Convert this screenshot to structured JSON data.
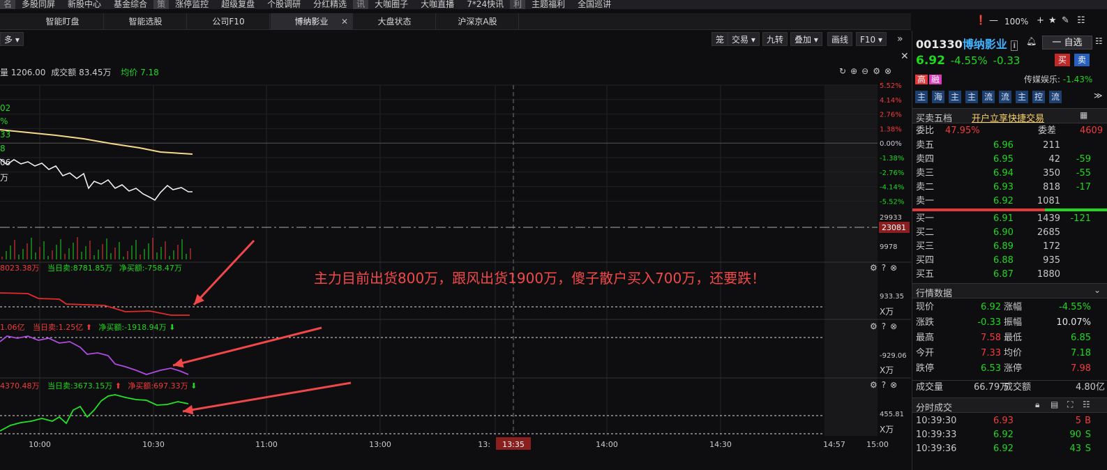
{
  "topnav": [
    "名",
    "多股同屏",
    "新股中心",
    "基金综合",
    "策",
    "涨停监控",
    "超级复盘",
    "个股调研",
    "分红精选",
    "讯",
    "大咖圈子",
    "大咖直播",
    "7*24快讯",
    "利",
    "主题福利",
    "全国巡讲"
  ],
  "tabs": [
    {
      "label": "智能盯盘",
      "active": false
    },
    {
      "label": "智能选股",
      "active": false
    },
    {
      "label": "公司F10",
      "active": false
    },
    {
      "label": "博纳影业",
      "active": true,
      "close": "✕"
    },
    {
      "label": "大盘状态",
      "active": false
    },
    {
      "label": "沪深京A股",
      "active": false
    }
  ],
  "window_controls": {
    "zoom": "100%"
  },
  "toolbar": {
    "more": "多",
    "btns": [
      "笼",
      "交易",
      "九转",
      "叠加",
      "画线",
      "F10"
    ]
  },
  "chart_header": {
    "vol": "量 1206.00",
    "amount": "成交额 83.45万",
    "avg": "均价 7.18"
  },
  "yaxis_pct": [
    "5.52%",
    "4.14%",
    "2.76%",
    "1.38%",
    "0.00%",
    "-1.38%",
    "-2.76%",
    "-4.14%",
    "-5.52%"
  ],
  "vol_axis": {
    "top": "29933",
    "mid": "23081",
    "low": "9978"
  },
  "left_edge_labels": [
    "02",
    "%",
    "33",
    "8",
    "06",
    "万"
  ],
  "panel1": {
    "label1": "8023.38万",
    "label2": "当日卖:8781.85万",
    "label3": "净买额:-758.47万",
    "axis": "933.35",
    "unit": "X万"
  },
  "panel2": {
    "label1": "1.06亿",
    "label2": "当日卖:1.25亿",
    "label3": "净买额:-1918.94万",
    "axis": "-929.06",
    "unit": "X万"
  },
  "panel3": {
    "label1": "4370.48万",
    "label2": "当日卖:3673.15万",
    "label3": "净买额:697.33万",
    "axis": "455.81",
    "unit": "X万"
  },
  "annotation": "主力目前出货800万，跟风出货1900万，傻子散户买入700万，还要跌！",
  "time_axis": [
    "10:00",
    "10:30",
    "11:00",
    "13:00",
    "13:35",
    "14:00",
    "14:30",
    "14:57",
    "15:00"
  ],
  "stock": {
    "code": "001330",
    "name": "博纳影业",
    "price": "6.92",
    "chg_pct": "-4.55%",
    "chg": "-0.33",
    "zixuan": "一 自选",
    "buy": "买",
    "sell": "卖",
    "tag1": "高",
    "tag2": "融",
    "sector": "传媒娱乐:",
    "sector_pct": "-1.43%"
  },
  "pills": [
    "主",
    "海",
    "主",
    "主",
    "流",
    "流",
    "主",
    "控",
    "流"
  ],
  "order_book": {
    "title": "买卖五档",
    "promo": "开户立享快捷交易",
    "weibi_label": "委比",
    "weibi": "47.95%",
    "weicha_label": "委差",
    "weicha": "4609",
    "asks": [
      {
        "l": "卖五",
        "p": "6.96",
        "v": "211",
        "d": ""
      },
      {
        "l": "卖四",
        "p": "6.95",
        "v": "42",
        "d": "-59"
      },
      {
        "l": "卖三",
        "p": "6.94",
        "v": "350",
        "d": "-55"
      },
      {
        "l": "卖二",
        "p": "6.93",
        "v": "818",
        "d": "-17"
      },
      {
        "l": "卖一",
        "p": "6.92",
        "v": "1081",
        "d": ""
      }
    ],
    "bids": [
      {
        "l": "买一",
        "p": "6.91",
        "v": "1439",
        "d": "-121"
      },
      {
        "l": "买二",
        "p": "6.90",
        "v": "2685",
        "d": ""
      },
      {
        "l": "买三",
        "p": "6.89",
        "v": "172",
        "d": ""
      },
      {
        "l": "买四",
        "p": "6.88",
        "v": "935",
        "d": ""
      },
      {
        "l": "买五",
        "p": "6.87",
        "v": "1880",
        "d": ""
      }
    ]
  },
  "quote": {
    "title": "行情数据",
    "rows": [
      {
        "a": "现价",
        "av": "6.92",
        "b": "涨幅",
        "bv": "-4.55%"
      },
      {
        "a": "涨跌",
        "av": "-0.33",
        "b": "振幅",
        "bv": "10.07%"
      },
      {
        "a": "最高",
        "av": "7.58",
        "b": "最低",
        "bv": "6.85"
      },
      {
        "a": "今开",
        "av": "7.33",
        "b": "均价",
        "bv": "7.18"
      },
      {
        "a": "跌停",
        "av": "6.53",
        "b": "涨停",
        "bv": "7.98"
      }
    ],
    "vol_label": "成交量",
    "vol": "66.79万",
    "amt_label": "成交额",
    "amt": "4.80亿"
  },
  "ticks": {
    "title": "分时成交",
    "rows": [
      {
        "t": "10:39:30",
        "p": "6.93",
        "v": "5",
        "s": "B"
      },
      {
        "t": "10:39:33",
        "p": "6.92",
        "v": "90",
        "s": "S"
      },
      {
        "t": "10:39:36",
        "p": "6.92",
        "v": "43",
        "s": "S"
      }
    ]
  },
  "colors": {
    "up": "#f23b3b",
    "down": "#1fd81f",
    "accent": "#f7d26b",
    "bg": "#0e0e10"
  }
}
